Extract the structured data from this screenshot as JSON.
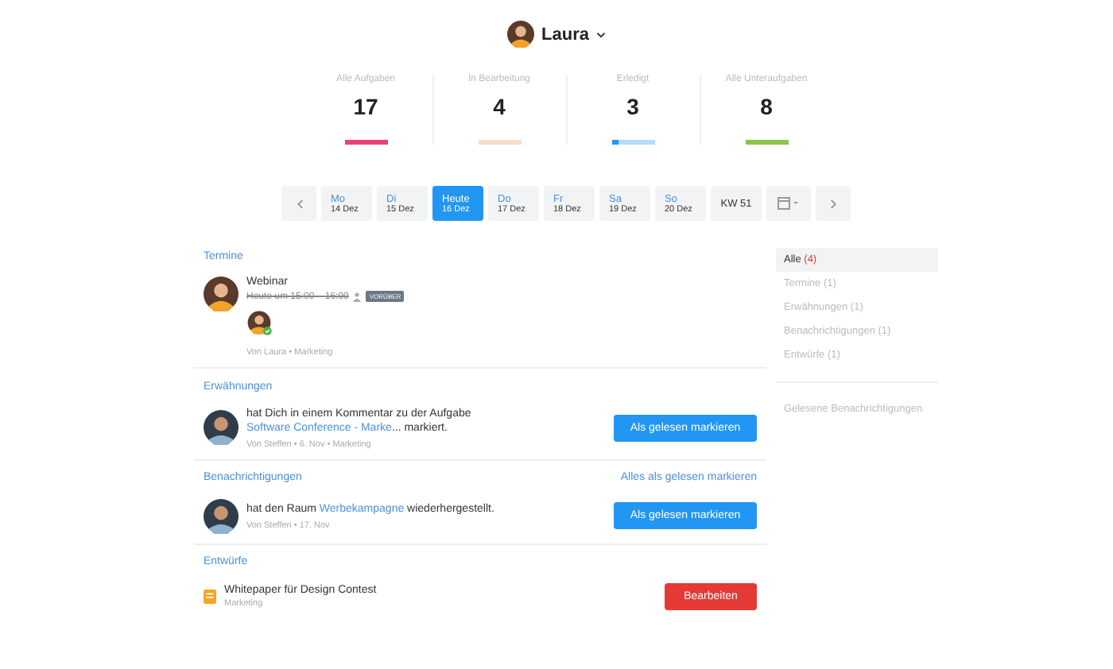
{
  "user": {
    "name": "Laura"
  },
  "stats": [
    {
      "label": "Alle Aufgaben",
      "value": "17",
      "level": 1,
      "color": "#e8417a"
    },
    {
      "label": "In Bearbeitung",
      "value": "4",
      "level": 1,
      "color": "#f8dcc8"
    },
    {
      "label": "Erledigt",
      "value": "3",
      "level": 0.15,
      "color": "#2196f3"
    },
    {
      "label": "Alle Unteraufgaben",
      "value": "8",
      "level": 1,
      "color": "#8bc34a"
    }
  ],
  "days": [
    {
      "day": "Mo",
      "date": "14 Dez",
      "selected": false
    },
    {
      "day": "Di",
      "date": "15 Dez",
      "selected": false
    },
    {
      "day": "Heute",
      "date": "16 Dez",
      "selected": true
    },
    {
      "day": "Do",
      "date": "17 Dez",
      "selected": false
    },
    {
      "day": "Fr",
      "date": "18 Dez",
      "selected": false
    },
    {
      "day": "Sa",
      "date": "19 Dez",
      "selected": false
    },
    {
      "day": "So",
      "date": "20 Dez",
      "selected": false
    }
  ],
  "week": "KW 51",
  "termine": {
    "title": "Termine",
    "event": {
      "name": "Webinar",
      "time": "Heute um 15:00 – 16:00",
      "badge": "VORÜBER",
      "meta": "Von Laura • Marketing"
    }
  },
  "mentions": {
    "title": "Erwähnungen",
    "item": {
      "before": "hat Dich in einem Kommentar zu der Aufgabe",
      "link": "Software Conference - Marke",
      "after": "... markiert.",
      "meta": "Von Steffen • 6. Nov • Marketing",
      "button": "Als gelesen markieren"
    }
  },
  "notifications": {
    "title": "Benachrichtigungen",
    "mark_all": "Alles als gelesen markieren",
    "item": {
      "before": "hat den Raum",
      "link": "Werbekampagne",
      "after": "wiederhergestellt.",
      "meta": "Von Steffen • 17. Nov",
      "button": "Als gelesen markieren"
    }
  },
  "drafts": {
    "title": "Entwürfe",
    "item": {
      "name": "Whitepaper für Design Contest",
      "meta": "Marketing",
      "button": "Bearbeiten"
    }
  },
  "sidebar": {
    "items": [
      {
        "label": "Alle",
        "count": "(4)",
        "selected": true
      },
      {
        "label": "Termine",
        "count": "(1)",
        "selected": false
      },
      {
        "label": "Erwähnungen",
        "count": "(1)",
        "selected": false
      },
      {
        "label": "Benachrichtigungen",
        "count": "(1)",
        "selected": false
      },
      {
        "label": "Entwürfe",
        "count": "(1)",
        "selected": false
      }
    ],
    "read": "Gelesene Benachrichtigungen"
  }
}
